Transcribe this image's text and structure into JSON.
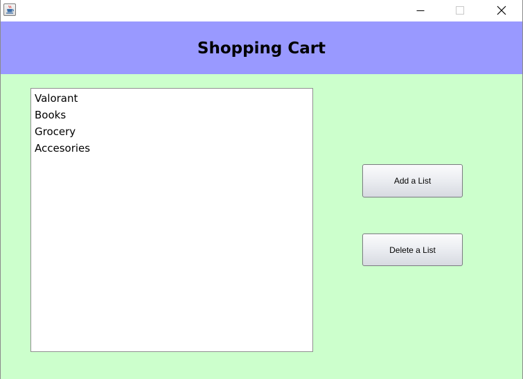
{
  "window": {
    "app_icon": "java-cup-icon",
    "controls": {
      "minimize_icon": "minimize-icon",
      "maximize_icon": "maximize-icon",
      "close_icon": "close-icon"
    }
  },
  "header": {
    "title": "Shopping Cart",
    "background_color": "#9999ff"
  },
  "content": {
    "background_color": "#ccffcc"
  },
  "list": {
    "items": [
      "Valorant",
      "Books",
      "Grocery",
      "Accesories"
    ]
  },
  "buttons": {
    "add_label": "Add a List",
    "delete_label": "Delete a List"
  }
}
